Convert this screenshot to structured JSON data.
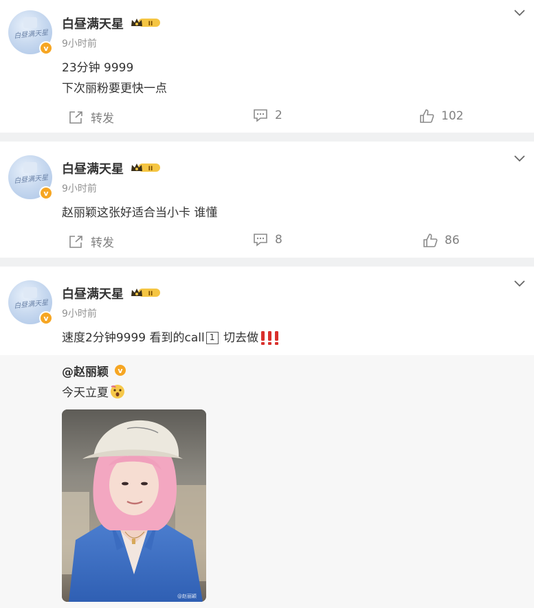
{
  "posts": [
    {
      "username": "白昼满天星",
      "avatar_text": "白昼满天星",
      "level_badge": "II",
      "time": "9小时前",
      "content_lines": [
        "23分钟 9999",
        "下次丽粉要更快一点"
      ],
      "repost_label": "转发",
      "comments": "2",
      "likes": "102"
    },
    {
      "username": "白昼满天星",
      "avatar_text": "白昼满天星",
      "level_badge": "II",
      "time": "9小时前",
      "content_lines": [
        "赵丽颖这张好适合当小卡 谁懂"
      ],
      "repost_label": "转发",
      "comments": "8",
      "likes": "86"
    },
    {
      "username": "白昼满天星",
      "avatar_text": "白昼满天星",
      "level_badge": "II",
      "time": "9小时前",
      "content_text": "速度2分钟9999 看到的call",
      "content_box": "1",
      "content_tail": " 切去做",
      "repost": {
        "mention": "@赵丽颖",
        "text": "今天立夏",
        "photo_watermark": "@赵丽颖"
      }
    }
  ],
  "colors": {
    "verified_badge": "#f6a623",
    "exclamation": "#d9302c",
    "muted_text": "#939393"
  }
}
